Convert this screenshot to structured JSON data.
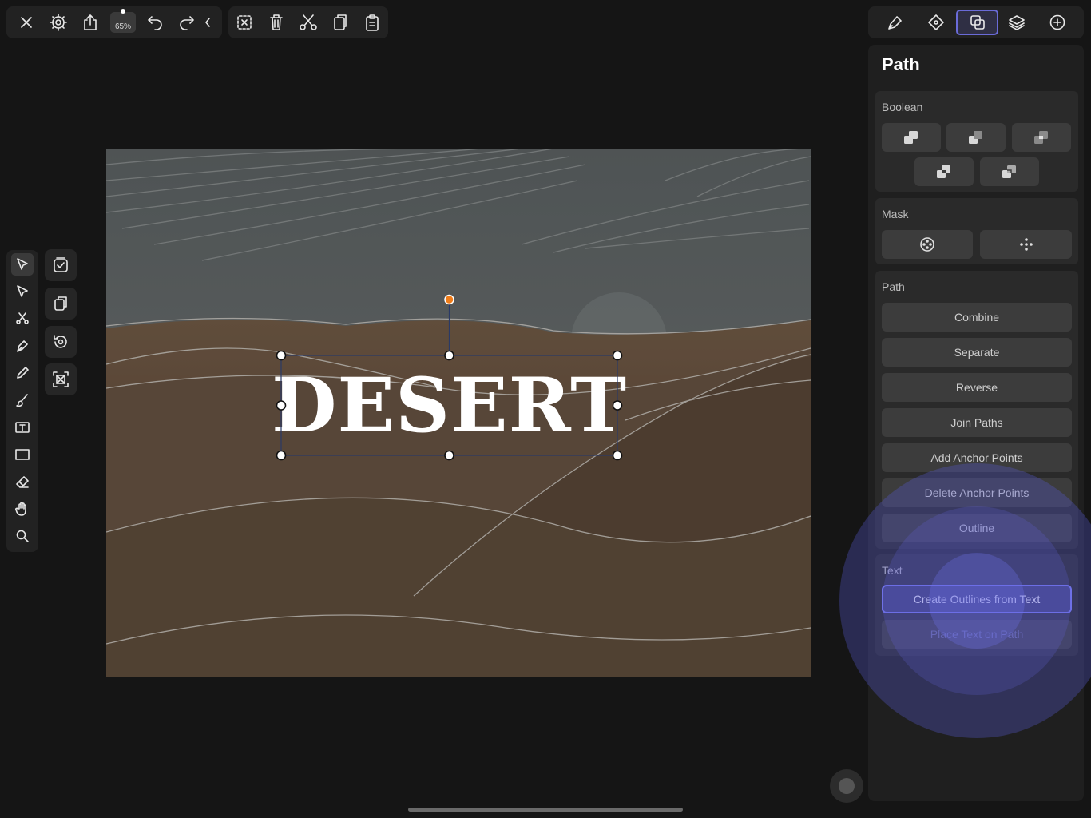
{
  "toolbar": {
    "zoom": "65%",
    "buttons": [
      "close-icon",
      "settings-icon",
      "share-icon",
      "undo-icon",
      "redo-icon",
      "collapse-icon"
    ],
    "edit_buttons": [
      "deselect-icon",
      "delete-icon",
      "cut-icon",
      "copy-icon",
      "paste-icon"
    ]
  },
  "right_toolbar": {
    "tabs": [
      "style-icon",
      "vector-icon",
      "path-operations-icon",
      "layers-icon",
      "add-icon"
    ],
    "active_tab": "path-operations-icon"
  },
  "canvas": {
    "text": "DESERT"
  },
  "panel": {
    "title": "Path",
    "boolean": {
      "title": "Boolean"
    },
    "mask": {
      "title": "Mask"
    },
    "path": {
      "title": "Path",
      "buttons": [
        "Combine",
        "Separate",
        "Reverse",
        "Join Paths",
        "Add Anchor Points",
        "Delete Anchor Points",
        "Outline"
      ]
    },
    "text": {
      "title": "Text",
      "buttons": [
        "Create Outlines from Text",
        "Place Text on Path"
      ]
    }
  },
  "colors": {
    "accent": "#6a6bd8",
    "rotation_handle": "#f07d1a",
    "highlight": "#5b5ce0"
  }
}
